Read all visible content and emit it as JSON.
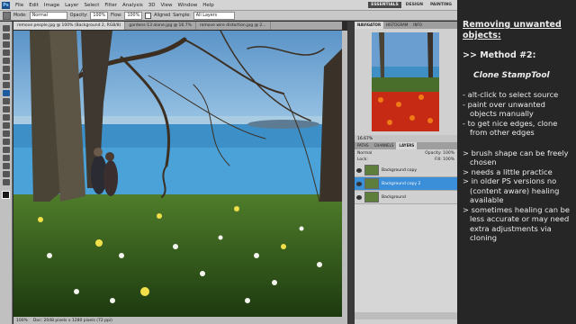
{
  "app": {
    "logo": "Ps",
    "menu": [
      "File",
      "Edit",
      "Image",
      "Layer",
      "Select",
      "Filter",
      "Analysis",
      "3D",
      "View",
      "Window",
      "Help"
    ],
    "workspaces": [
      "ESSENTIALS",
      "DESIGN",
      "PAINTING"
    ],
    "active_workspace": "ESSENTIALS"
  },
  "options": {
    "mode_label": "Mode:",
    "mode_value": "Normal",
    "opacity_label": "Opacity:",
    "opacity_value": "100%",
    "flow_label": "Flow:",
    "flow_value": "100%",
    "aligned_label": "Aligned",
    "sample_label": "Sample:",
    "sample_value": "All Layers"
  },
  "doc_tabs": [
    "remove people.jpg @ 100% (Background 2, RGB/8)",
    "gardens-13 alone.jpg @ 16.7%",
    "remove wire distortion.jpg @ 2..."
  ],
  "status": {
    "zoom": "100%",
    "doc_size": "Doc: 2048 pixels x 1280 pixels (72 ppi)"
  },
  "panels": {
    "nav_tabs": [
      "NAVIGATOR",
      "HISTOGRAM",
      "INFO"
    ],
    "nav_zoom": "16.67%",
    "layer_tabs": [
      "PATHS",
      "CHANNELS",
      "LAYERS"
    ],
    "blend_mode": "Normal",
    "opacity_label": "Opacity:",
    "opacity_value": "100%",
    "lock_label": "Lock:",
    "fill_label": "Fill:",
    "fill_value": "100%",
    "layers": [
      {
        "name": "Background copy",
        "selected": false
      },
      {
        "name": "Background copy 2",
        "selected": true
      },
      {
        "name": "Background",
        "selected": false
      }
    ]
  },
  "notes": {
    "title": "Removing unwanted objects:",
    "method": ">> Method #2:",
    "tool": "Clone StampTool",
    "steps": [
      "- alt-click to select source",
      "- paint over unwanted objects manually",
      "- to get nice edges, clone from other edges"
    ],
    "tips": [
      "> brush shape can be freely chosen",
      "> needs a little practice",
      "> in older PS versions no (content aware) healing available",
      "> sometimes healing can be less accurate or may need extra adjustments via cloning"
    ]
  }
}
